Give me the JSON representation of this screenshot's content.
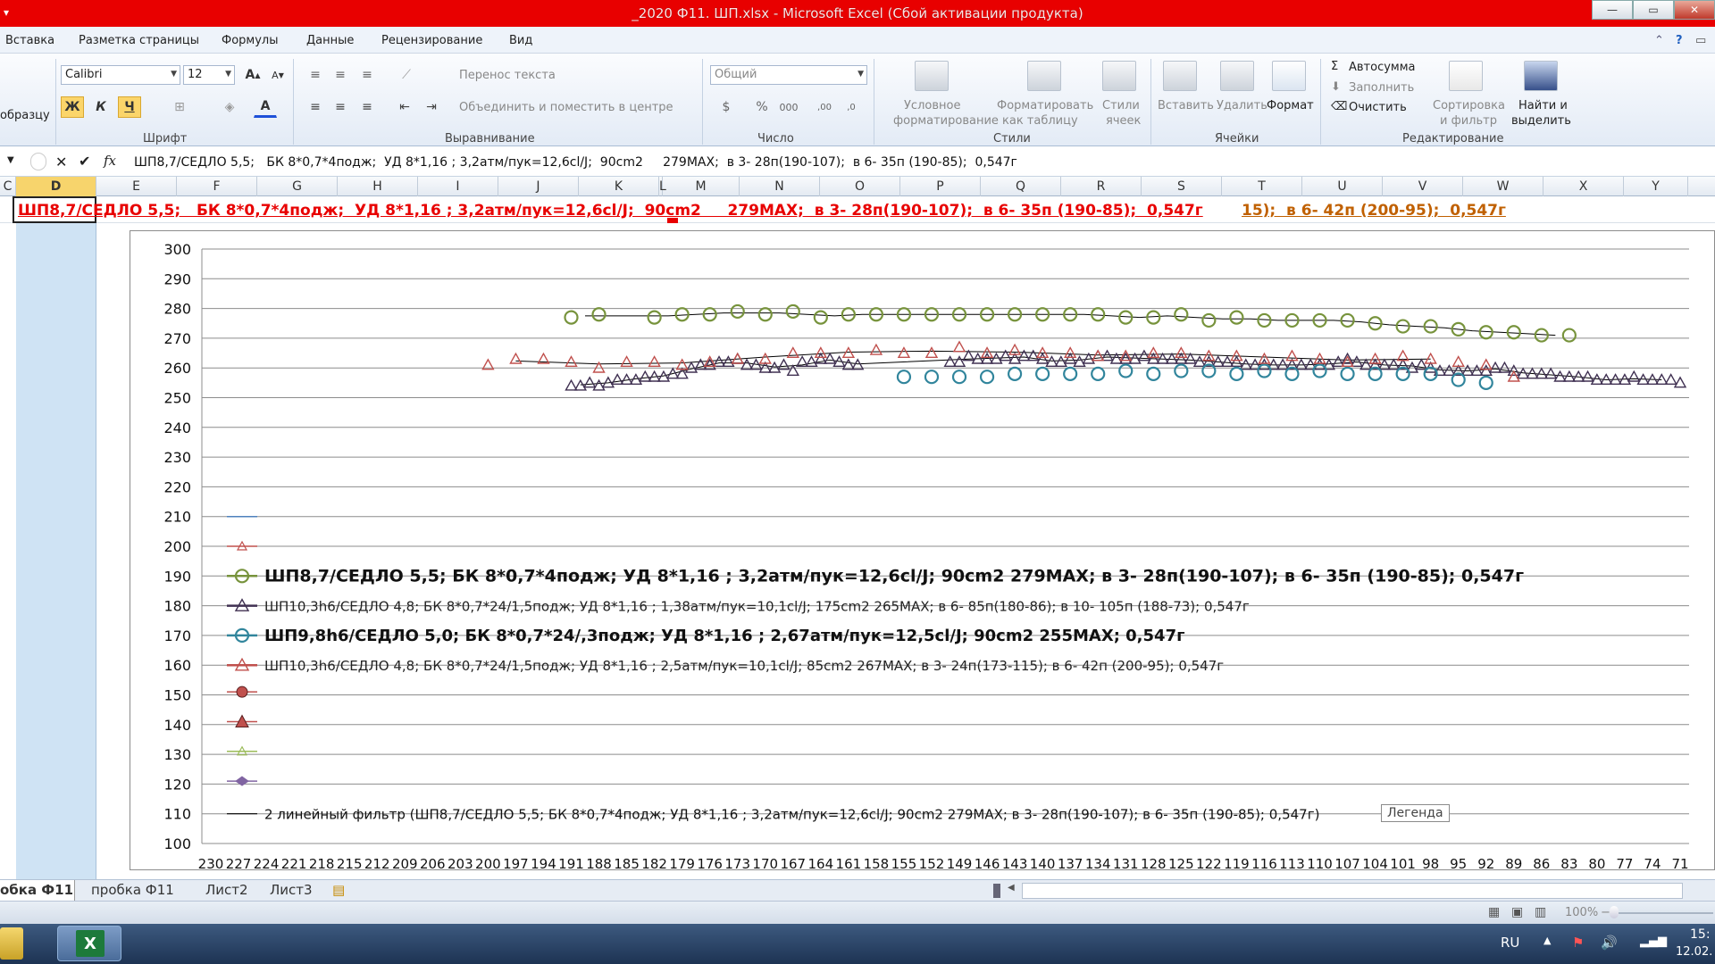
{
  "window": {
    "title": "_2020 Ф11.  ШП.xlsx  -  Microsoft Excel (Сбой активации продукта)"
  },
  "menu": [
    "Вставка",
    "Разметка страницы",
    "Формулы",
    "Данные",
    "Рецензирование",
    "Вид"
  ],
  "ribbon": {
    "clipboard_fragment": "образцу",
    "font_group": "Шрифт",
    "font_name": "Calibri",
    "font_size": "12",
    "bold": "Ж",
    "italic": "К",
    "underline": "Ч",
    "align_group": "Выравнивание",
    "wrap_text": "Перенос текста",
    "merge_center": "Объединить и поместить в центре",
    "number_group": "Число",
    "number_format": "Общий",
    "styles_group": "Стили",
    "cond_format_1": "Условное",
    "cond_format_2": "форматирование",
    "format_table_1": "Форматировать",
    "format_table_2": "как таблицу",
    "cell_styles_1": "Стили",
    "cell_styles_2": "ячеек",
    "cells_group": "Ячейки",
    "insert": "Вставить",
    "delete": "Удалить",
    "format": "Формат",
    "editing_group": "Редактирование",
    "autosum": "Автосумма",
    "fill": "Заполнить",
    "clear": "Очистить",
    "sort_filter_1": "Сортировка",
    "sort_filter_2": "и фильтр",
    "find_select_1": "Найти и",
    "find_select_2": "выделить"
  },
  "formula_bar": {
    "content": "ШП8,7/СЕДЛО 5,5;   БК 8*0,7*4подж;  УД 8*1,16 ; 3,2атм/пук=12,6cl/J;  90cm2     279MAX;  в 3- 28п(190-107);  в 6- 35п (190-85);  0,547г"
  },
  "columns": [
    "C",
    "D",
    "E",
    "F",
    "G",
    "H",
    "I",
    "J",
    "K",
    "L",
    "M",
    "N",
    "O",
    "P",
    "Q",
    "R",
    "S",
    "T",
    "U",
    "V",
    "W",
    "X",
    "Y"
  ],
  "row1": {
    "text": "ШП8,7/СЕДЛО 5,5;   БК 8*0,7*4подж;  УД 8*1,16 ; 3,2атм/пук=12,6cl/J;  90cm2     279MAX;  в 3- 28п(190-107);  в 6- 35п (190-85);  0,547г",
    "text2": "15);  в 6- 42п (200-95);  0,547г"
  },
  "chart_data": {
    "type": "line",
    "ylim": [
      100,
      300
    ],
    "yticks": [
      300,
      290,
      280,
      270,
      260,
      250,
      240,
      230,
      220,
      210,
      200,
      190,
      180,
      170,
      160,
      150,
      140,
      130,
      120,
      110,
      100
    ],
    "x_tick_labels": [
      "230",
      "227",
      "224",
      "221",
      "218",
      "215",
      "212",
      "209",
      "206",
      "203",
      "200",
      "197",
      "194",
      "191",
      "188",
      "185",
      "182",
      "179",
      "176",
      "173",
      "170",
      "167",
      "164",
      "161",
      "158",
      "155",
      "152",
      "149",
      "146",
      "143",
      "140",
      "137",
      "134",
      "131",
      "128",
      "125",
      "122",
      "119",
      "116",
      "113",
      "110",
      "107",
      "104",
      "101",
      "98",
      "95",
      "92",
      "89",
      "86",
      "83",
      "80",
      "77",
      "74",
      "71"
    ],
    "series": [
      {
        "name": "ШП8,7/СЕДЛО 5,5;   БК 8*0,7*4подж;  УД 8*1,16 ; 3,2атм/пук=12,6cl/J;  90cm2     279MAX;  в 3- 28п(190-107);  в 6- 35п (190-85);  0,547г",
        "color": "#77933c",
        "marker": "circle",
        "x": [
          191,
          188,
          182,
          179,
          176,
          173,
          170,
          167,
          164,
          161,
          158,
          155,
          152,
          149,
          146,
          143,
          140,
          137,
          134,
          131,
          128,
          125,
          122,
          119,
          116,
          113,
          110,
          107,
          104,
          101,
          98,
          95,
          92,
          89,
          86,
          83
        ],
        "y": [
          277,
          278,
          277,
          278,
          278,
          279,
          278,
          279,
          277,
          278,
          278,
          278,
          278,
          278,
          278,
          278,
          278,
          278,
          278,
          277,
          277,
          278,
          276,
          277,
          276,
          276,
          276,
          276,
          275,
          274,
          274,
          273,
          272,
          272,
          271,
          271
        ]
      },
      {
        "name": "ШП10,3h6/СЕДЛО 4,8;   БК 8*0,7*24/1,5подж;  УД 8*1,16 ; 1,38атм/пук=10,1cl/J;  175cm2     265MAX;  в 6- 85п(180-86);  в 10- 105п (188-73);  0,547г",
        "color": "#403152",
        "marker": "triangle",
        "x": [
          191,
          190,
          189,
          188,
          187,
          186,
          185,
          184,
          183,
          182,
          181,
          180,
          179,
          178,
          177,
          176,
          175,
          174,
          173,
          172,
          171,
          170,
          169,
          168,
          167,
          166,
          165,
          164,
          163,
          162,
          161,
          160,
          150,
          149,
          148,
          147,
          146,
          145,
          144,
          143,
          142,
          141,
          140,
          139,
          138,
          137,
          136,
          135,
          134,
          133,
          132,
          131,
          130,
          129,
          128,
          127,
          126,
          125,
          124,
          123,
          122,
          121,
          120,
          119,
          118,
          117,
          116,
          115,
          114,
          113,
          112,
          111,
          110,
          109,
          108,
          107,
          106,
          105,
          104,
          103,
          102,
          101,
          100,
          99,
          98,
          97,
          96,
          95,
          94,
          93,
          92,
          91,
          90,
          89,
          88,
          87,
          86,
          85,
          84,
          83,
          82,
          81,
          80,
          79,
          78,
          77,
          76,
          75,
          74,
          73,
          72,
          71
        ],
        "y": [
          254,
          254,
          255,
          254,
          255,
          256,
          256,
          256,
          257,
          257,
          257,
          258,
          258,
          260,
          261,
          261,
          262,
          262,
          263,
          261,
          261,
          260,
          260,
          261,
          259,
          262,
          262,
          263,
          263,
          262,
          261,
          261,
          262,
          262,
          264,
          263,
          263,
          263,
          264,
          263,
          264,
          264,
          263,
          262,
          262,
          263,
          262,
          263,
          264,
          264,
          263,
          263,
          263,
          264,
          263,
          263,
          263,
          263,
          263,
          262,
          262,
          262,
          262,
          262,
          261,
          261,
          261,
          261,
          261,
          261,
          261,
          261,
          261,
          261,
          262,
          263,
          262,
          261,
          261,
          261,
          261,
          261,
          260,
          261,
          260,
          259,
          259,
          259,
          259,
          259,
          259,
          260,
          260,
          259,
          258,
          258,
          258,
          258,
          257,
          257,
          257,
          257,
          256,
          256,
          256,
          256,
          257,
          256,
          256,
          256,
          256,
          255
        ]
      },
      {
        "name": "ШП9,8h6/СЕДЛО 5,0;   БК 8*0,7*24/,3подж;  УД 8*1,16 ; 2,67атм/пук=12,5cl/J;  90cm2     255MAX;     0,547г",
        "color": "#31859c",
        "marker": "circle",
        "x": [
          155,
          152,
          149,
          146,
          143,
          140,
          137,
          134,
          131,
          128,
          125,
          122,
          119,
          116,
          113,
          110,
          107,
          104,
          101,
          98,
          95,
          92
        ],
        "y": [
          257,
          257,
          257,
          257,
          258,
          258,
          258,
          258,
          259,
          258,
          259,
          259,
          258,
          259,
          258,
          259,
          258,
          258,
          258,
          258,
          256,
          255
        ]
      },
      {
        "name": "ШП10,3h6/СЕДЛО 4,8;   БК 8*0,7*24/1,5подж;  УД 8*1,16 ; 2,5атм/пук=10,1cl/J; 85cm2     267MAX;  в 3- 24п(173-115);  в 6- 42п (200-95);  0,547г",
        "color": "#c0504d",
        "marker": "triangle",
        "x": [
          200,
          197,
          194,
          191,
          188,
          185,
          182,
          179,
          176,
          173,
          170,
          167,
          164,
          161,
          158,
          155,
          152,
          149,
          146,
          143,
          140,
          137,
          134,
          131,
          128,
          125,
          122,
          119,
          116,
          113,
          110,
          107,
          104,
          101,
          98,
          95,
          92,
          89
        ],
        "y": [
          261,
          263,
          263,
          262,
          260,
          262,
          262,
          261,
          262,
          263,
          263,
          265,
          265,
          265,
          266,
          265,
          265,
          267,
          265,
          266,
          265,
          265,
          264,
          264,
          265,
          265,
          264,
          264,
          263,
          264,
          263,
          262,
          263,
          264,
          263,
          262,
          261,
          257
        ]
      },
      {
        "name": "2 линейный фильтр (ШП8,7/СЕДЛО 5,5;   БК 8*0,7*4подж;  УД 8*1,16 ; 3,2атм/пук=12,6cl/J;  90cm2     279MAX;  в 3- 28п(190-107);  в 6- 35п (190-85);  0,547г)",
        "color": "#000000",
        "marker": "none"
      }
    ],
    "extra_legend_markers": [
      {
        "y": 210,
        "color": "#4f81bd",
        "marker": "line"
      },
      {
        "y": 200,
        "color": "#c0504d",
        "marker": "triangle-small"
      },
      {
        "y": 151,
        "color": "#c0504d",
        "marker": "circle-filled"
      },
      {
        "y": 141,
        "color": "#c0504d",
        "marker": "triangle-filled"
      },
      {
        "y": 131,
        "color": "#9bbb59",
        "marker": "triangle-small"
      },
      {
        "y": 121,
        "color": "#8064a2",
        "marker": "diamond"
      }
    ],
    "legend_tooltip": "Легенда"
  },
  "sheet_tabs": [
    "обка Ф11",
    "пробка  Ф11",
    "Лист2",
    "Лист3"
  ],
  "status": {
    "zoom": "100%"
  },
  "taskbar": {
    "lang": "RU",
    "time": "15:",
    "date": "12.02."
  }
}
